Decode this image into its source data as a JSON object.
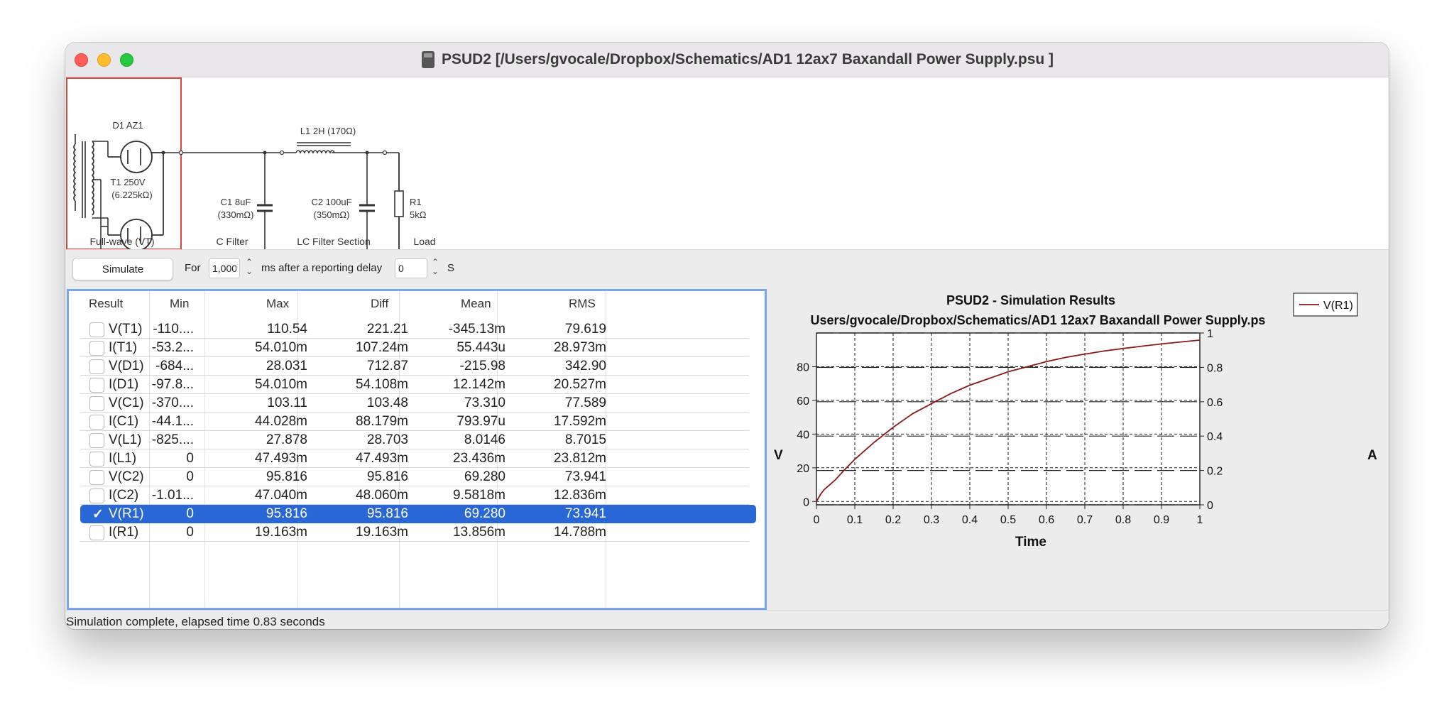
{
  "window": {
    "title": "PSUD2  [/Users/gvocale/Dropbox/Schematics/AD1 12ax7 Baxandall Power Supply.psu ]"
  },
  "schematic": {
    "d1": "D1 AZ1",
    "t1_line1": "T1 250V",
    "t1_line2": "(6.225kΩ)",
    "section1": "Full-wave (VT)",
    "l1": "L1 2H (170Ω)",
    "c1_line1": "C1 8uF",
    "c1_line2": "(330mΩ)",
    "section2": "C Filter",
    "c2_line1": "C2 100uF",
    "c2_line2": "(350mΩ)",
    "section3": "LC Filter Section",
    "r1_line1": "R1",
    "r1_line2": "5kΩ",
    "section4": "Load"
  },
  "toolbar": {
    "simulate": "Simulate",
    "for_label": "For",
    "duration": "1,000",
    "mid_label": "ms after a reporting delay",
    "delay": "0",
    "unit": "S"
  },
  "table": {
    "headers": [
      "Result",
      "Min",
      "Max",
      "Diff",
      "Mean",
      "RMS"
    ],
    "rows": [
      {
        "name": "V(T1)",
        "min": "-110....",
        "max": "110.54",
        "diff": "221.21",
        "mean": "-345.13m",
        "rms": "79.619",
        "checked": false
      },
      {
        "name": "I(T1)",
        "min": "-53.2...",
        "max": "54.010m",
        "diff": "107.24m",
        "mean": "55.443u",
        "rms": "28.973m",
        "checked": false
      },
      {
        "name": "V(D1)",
        "min": "-684...",
        "max": "28.031",
        "diff": "712.87",
        "mean": "-215.98",
        "rms": "342.90",
        "checked": false
      },
      {
        "name": "I(D1)",
        "min": "-97.8...",
        "max": "54.010m",
        "diff": "54.108m",
        "mean": "12.142m",
        "rms": "20.527m",
        "checked": false
      },
      {
        "name": "V(C1)",
        "min": "-370....",
        "max": "103.11",
        "diff": "103.48",
        "mean": "73.310",
        "rms": "77.589",
        "checked": false
      },
      {
        "name": "I(C1)",
        "min": "-44.1...",
        "max": "44.028m",
        "diff": "88.179m",
        "mean": "793.97u",
        "rms": "17.592m",
        "checked": false
      },
      {
        "name": "V(L1)",
        "min": "-825....",
        "max": "27.878",
        "diff": "28.703",
        "mean": "8.0146",
        "rms": "8.7015",
        "checked": false
      },
      {
        "name": "I(L1)",
        "min": "0",
        "max": "47.493m",
        "diff": "47.493m",
        "mean": "23.436m",
        "rms": "23.812m",
        "checked": false
      },
      {
        "name": "V(C2)",
        "min": "0",
        "max": "95.816",
        "diff": "95.816",
        "mean": "69.280",
        "rms": "73.941",
        "checked": false
      },
      {
        "name": "I(C2)",
        "min": "-1.01...",
        "max": "47.040m",
        "diff": "48.060m",
        "mean": "9.5818m",
        "rms": "12.836m",
        "checked": false
      },
      {
        "name": "V(R1)",
        "min": "0",
        "max": "95.816",
        "diff": "95.816",
        "mean": "69.280",
        "rms": "73.941",
        "checked": true
      },
      {
        "name": "I(R1)",
        "min": "0",
        "max": "19.163m",
        "diff": "19.163m",
        "mean": "13.856m",
        "rms": "14.788m",
        "checked": false
      }
    ]
  },
  "chart_data": {
    "type": "line",
    "title": "PSUD2 - Simulation Results",
    "subtitle": "Users/gvocale/Dropbox/Schematics/AD1 12ax7 Baxandall Power Supply.ps",
    "xlabel": "Time",
    "ylabel": "V",
    "y2label": "A",
    "xlim": [
      0,
      1
    ],
    "ylim": [
      -2,
      100
    ],
    "y2lim": [
      0,
      1
    ],
    "xticks": [
      "0",
      "0.1",
      "0.2",
      "0.3",
      "0.4",
      "0.5",
      "0.6",
      "0.7",
      "0.8",
      "0.9",
      "1"
    ],
    "yticks": [
      "0",
      "20",
      "40",
      "60",
      "80"
    ],
    "y2ticks": [
      "0",
      "0.2",
      "0.4",
      "0.6",
      "0.8",
      "1"
    ],
    "grid": true,
    "legend_position": "top-right",
    "series": [
      {
        "name": "V(R1)",
        "color": "#8b1a1a",
        "x": [
          0,
          0.005,
          0.01,
          0.02,
          0.03,
          0.05,
          0.07,
          0.1,
          0.15,
          0.2,
          0.25,
          0.3,
          0.35,
          0.4,
          0.45,
          0.5,
          0.55,
          0.6,
          0.65,
          0.7,
          0.75,
          0.8,
          0.85,
          0.9,
          0.95,
          1.0
        ],
        "y": [
          0,
          2,
          4,
          7,
          9,
          13,
          18,
          25,
          35,
          44,
          52,
          58,
          64,
          69,
          73,
          77,
          80,
          83,
          85.5,
          87.5,
          89.3,
          90.8,
          92.2,
          93.5,
          94.7,
          95.8
        ]
      }
    ]
  }
}
